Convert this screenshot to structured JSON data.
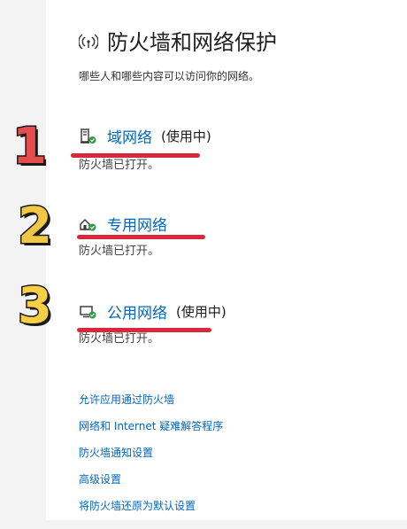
{
  "header": {
    "icon": "wifi-shield-icon",
    "title": "防火墙和网络保护"
  },
  "subtitle": "哪些人和哪些内容可以访问你的网络。",
  "annotations": {
    "num1": "1",
    "num2": "2",
    "num3": "3",
    "accent_red": "#d8283c"
  },
  "networks": [
    {
      "icon": "domain-network-icon",
      "name": "域网络",
      "tag": "(使用中)",
      "status": "防火墙已打开。"
    },
    {
      "icon": "private-network-icon",
      "name": "专用网络",
      "tag": "",
      "status": "防火墙已打开。"
    },
    {
      "icon": "public-network-icon",
      "name": "公用网络",
      "tag": "(使用中)",
      "status": "防火墙已打开。"
    }
  ],
  "links": [
    "允许应用通过防火墙",
    "网络和 Internet 疑难解答程序",
    "防火墙通知设置",
    "高级设置",
    "将防火墙还原为默认设置"
  ],
  "colors": {
    "link": "#0067c0",
    "check": "#2f9e44"
  }
}
